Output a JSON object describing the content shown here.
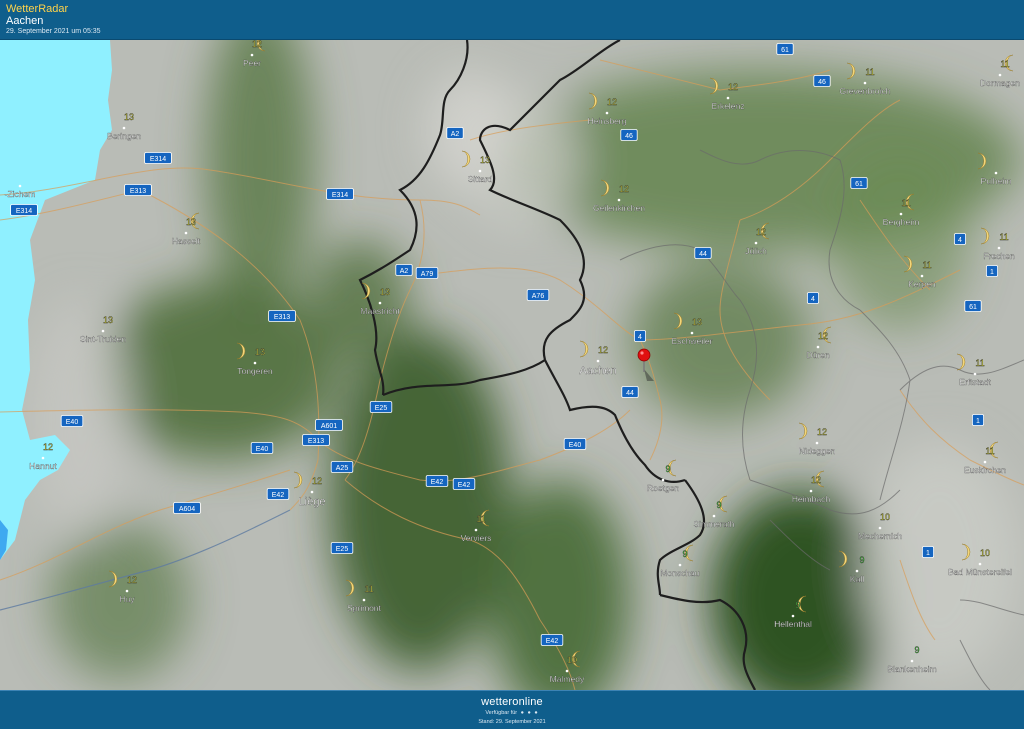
{
  "header": {
    "app_title": "WetterRadar",
    "location": "Aachen",
    "timestamp": "29. September 2021 um 05:35"
  },
  "footer": {
    "brand": "wetteronline",
    "available_label": "Verfügbar für",
    "platform_dots": "● ● ●",
    "stand": "Stand: 29. September 2021"
  },
  "colors": {
    "header_bg": "#0f5e8c",
    "app_title": "#ffd34a",
    "temp_yellow": "#ffff3c",
    "temp_green": "#4cff3c",
    "marker": "#e01010",
    "water": "#8ff0ff",
    "road_badge": "#1565c0"
  },
  "map": {
    "marker": {
      "name": "Aachen",
      "icon": "map-pin-icon"
    },
    "cities": [
      {
        "name": "Peer",
        "temp": "12",
        "moon": "right",
        "color": "yellow"
      },
      {
        "name": "Beringen",
        "temp": "13",
        "moon": "none",
        "color": "yellow"
      },
      {
        "name": "-Zichem",
        "temp": "",
        "moon": "none",
        "color": "yellow"
      },
      {
        "name": "Hasselt",
        "temp": "13",
        "moon": "right",
        "color": "yellow"
      },
      {
        "name": "Sint-Truiden",
        "temp": "13",
        "moon": "none",
        "color": "yellow"
      },
      {
        "name": "Tongeren",
        "temp": "13",
        "moon": "left",
        "color": "yellow"
      },
      {
        "name": "Hannut",
        "temp": "12",
        "moon": "none",
        "color": "yellow"
      },
      {
        "name": "Huy",
        "temp": "12",
        "moon": "left",
        "color": "yellow"
      },
      {
        "name": "Liège",
        "temp": "12",
        "moon": "left",
        "color": "yellow"
      },
      {
        "name": "Sprimont",
        "temp": "11",
        "moon": "left",
        "color": "yellow"
      },
      {
        "name": "Verviers",
        "temp": "11",
        "moon": "right",
        "color": "yellow"
      },
      {
        "name": "Malmedy",
        "temp": "10",
        "moon": "right",
        "color": "yellow"
      },
      {
        "name": "Maastricht",
        "temp": "13",
        "moon": "left",
        "color": "yellow"
      },
      {
        "name": "Sittard",
        "temp": "13",
        "moon": "left",
        "color": "yellow"
      },
      {
        "name": "Heinsberg",
        "temp": "12",
        "moon": "left",
        "color": "yellow"
      },
      {
        "name": "Geilenkirchen",
        "temp": "12",
        "moon": "left",
        "color": "yellow"
      },
      {
        "name": "Aachen",
        "temp": "12",
        "moon": "left",
        "color": "yellow"
      },
      {
        "name": "Eschweiler",
        "temp": "13",
        "moon": "left",
        "color": "yellow"
      },
      {
        "name": "Roetgen",
        "temp": "9",
        "moon": "right",
        "color": "green"
      },
      {
        "name": "Simmerath",
        "temp": "9",
        "moon": "right",
        "color": "green"
      },
      {
        "name": "Monschau",
        "temp": "9",
        "moon": "right",
        "color": "green"
      },
      {
        "name": "Hellenthal",
        "temp": "9",
        "moon": "right",
        "color": "green"
      },
      {
        "name": "Erkelenz",
        "temp": "12",
        "moon": "left",
        "color": "yellow"
      },
      {
        "name": "Jülich",
        "temp": "12",
        "moon": "right",
        "color": "yellow"
      },
      {
        "name": "Düren",
        "temp": "12",
        "moon": "right",
        "color": "yellow"
      },
      {
        "name": "Nideggen",
        "temp": "12",
        "moon": "left",
        "color": "yellow"
      },
      {
        "name": "Heimbach",
        "temp": "12",
        "moon": "right",
        "color": "yellow"
      },
      {
        "name": "Mechernich",
        "temp": "10",
        "moon": "none",
        "color": "yellow"
      },
      {
        "name": "Kall",
        "temp": "9",
        "moon": "left",
        "color": "green"
      },
      {
        "name": "Blankenheim",
        "temp": "9",
        "moon": "none",
        "color": "green"
      },
      {
        "name": "Bad Münstereifel",
        "temp": "10",
        "moon": "left",
        "color": "yellow"
      },
      {
        "name": "Euskirchen",
        "temp": "11",
        "moon": "right",
        "color": "yellow"
      },
      {
        "name": "Erftstadt",
        "temp": "11",
        "moon": "left",
        "color": "yellow"
      },
      {
        "name": "Kerpen",
        "temp": "11",
        "moon": "left",
        "color": "yellow"
      },
      {
        "name": "Bergheim",
        "temp": "11",
        "moon": "right",
        "color": "yellow"
      },
      {
        "name": "Frechen",
        "temp": "11",
        "moon": "left",
        "color": "yellow"
      },
      {
        "name": "Pulheim",
        "temp": "",
        "moon": "left",
        "color": "yellow"
      },
      {
        "name": "Grevenbroich",
        "temp": "11",
        "moon": "left",
        "color": "yellow"
      },
      {
        "name": "Dormagen",
        "temp": "11",
        "moon": "right",
        "color": "yellow"
      }
    ],
    "roads": [
      "61",
      "46",
      "A2",
      "46",
      "E314",
      "E313",
      "E314",
      "E314",
      "A2",
      "A79",
      "A76",
      "44",
      "4",
      "4",
      "61",
      "4",
      "1",
      "61",
      "E313",
      "4",
      "E25",
      "A601",
      "E313",
      "E40",
      "44",
      "E40",
      "A25",
      "E40",
      "E42",
      "A604",
      "E42",
      "E25",
      "E42",
      "E42",
      "1",
      "1"
    ]
  }
}
